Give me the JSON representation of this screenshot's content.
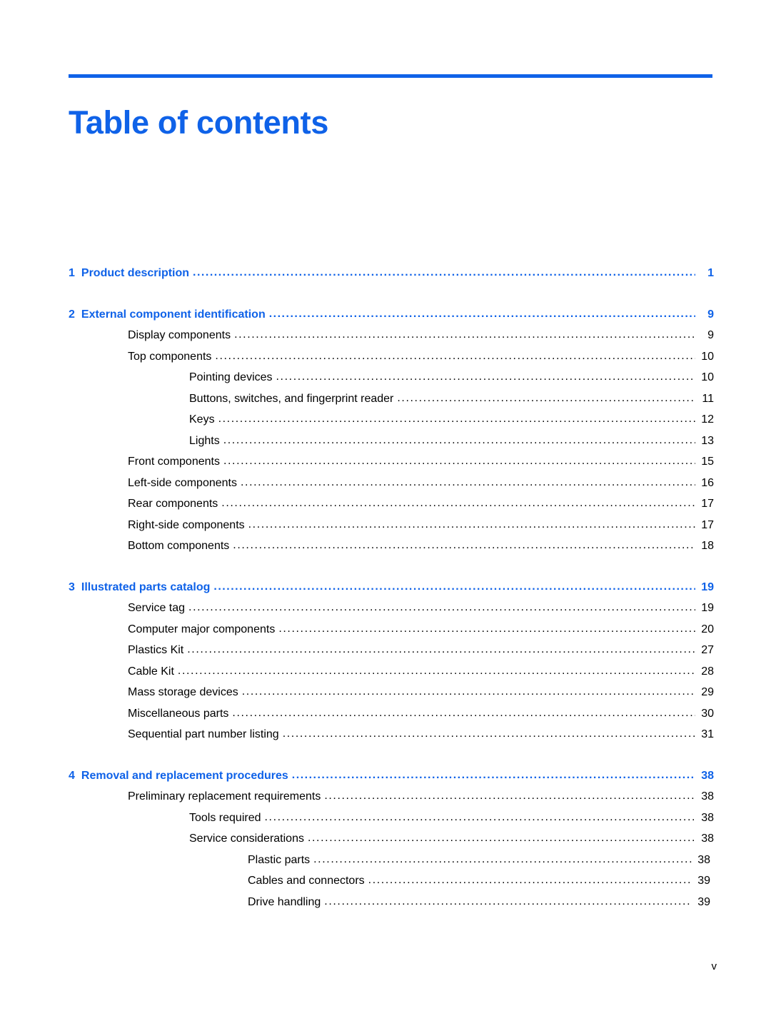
{
  "document": {
    "title": "Table of contents",
    "accent_color": "#0f62e8",
    "footer_page_label": "v"
  },
  "toc": {
    "leader_char": ".",
    "entries": [
      {
        "level": 0,
        "number": "1",
        "label": "Product description",
        "page": "1"
      },
      {
        "level": 0,
        "number": "2",
        "label": "External component identification",
        "page": "9"
      },
      {
        "level": 1,
        "number": "",
        "label": "Display components",
        "page": "9"
      },
      {
        "level": 1,
        "number": "",
        "label": "Top components",
        "page": "10"
      },
      {
        "level": 2,
        "number": "",
        "label": "Pointing devices",
        "page": "10"
      },
      {
        "level": 2,
        "number": "",
        "label": "Buttons, switches, and fingerprint reader",
        "page": "11"
      },
      {
        "level": 2,
        "number": "",
        "label": "Keys",
        "page": "12"
      },
      {
        "level": 2,
        "number": "",
        "label": "Lights",
        "page": "13"
      },
      {
        "level": 1,
        "number": "",
        "label": "Front components",
        "page": "15"
      },
      {
        "level": 1,
        "number": "",
        "label": "Left-side components",
        "page": "16"
      },
      {
        "level": 1,
        "number": "",
        "label": "Rear components",
        "page": "17"
      },
      {
        "level": 1,
        "number": "",
        "label": "Right-side components",
        "page": "17"
      },
      {
        "level": 1,
        "number": "",
        "label": "Bottom components",
        "page": "18"
      },
      {
        "level": 0,
        "number": "3",
        "label": "Illustrated parts catalog",
        "page": "19"
      },
      {
        "level": 1,
        "number": "",
        "label": "Service tag",
        "page": "19"
      },
      {
        "level": 1,
        "number": "",
        "label": "Computer major components",
        "page": "20"
      },
      {
        "level": 1,
        "number": "",
        "label": "Plastics Kit",
        "page": "27"
      },
      {
        "level": 1,
        "number": "",
        "label": "Cable Kit",
        "page": "28"
      },
      {
        "level": 1,
        "number": "",
        "label": "Mass storage devices",
        "page": "29"
      },
      {
        "level": 1,
        "number": "",
        "label": "Miscellaneous parts",
        "page": "30"
      },
      {
        "level": 1,
        "number": "",
        "label": "Sequential part number listing",
        "page": "31"
      },
      {
        "level": 0,
        "number": "4",
        "label": "Removal and replacement procedures",
        "page": "38"
      },
      {
        "level": 1,
        "number": "",
        "label": "Preliminary replacement requirements",
        "page": "38"
      },
      {
        "level": 2,
        "number": "",
        "label": "Tools required",
        "page": "38"
      },
      {
        "level": 2,
        "number": "",
        "label": "Service considerations",
        "page": "38"
      },
      {
        "level": 3,
        "number": "",
        "label": "Plastic parts",
        "page": "38"
      },
      {
        "level": 3,
        "number": "",
        "label": "Cables and connectors",
        "page": "39"
      },
      {
        "level": 3,
        "number": "",
        "label": "Drive handling",
        "page": "39"
      }
    ]
  }
}
